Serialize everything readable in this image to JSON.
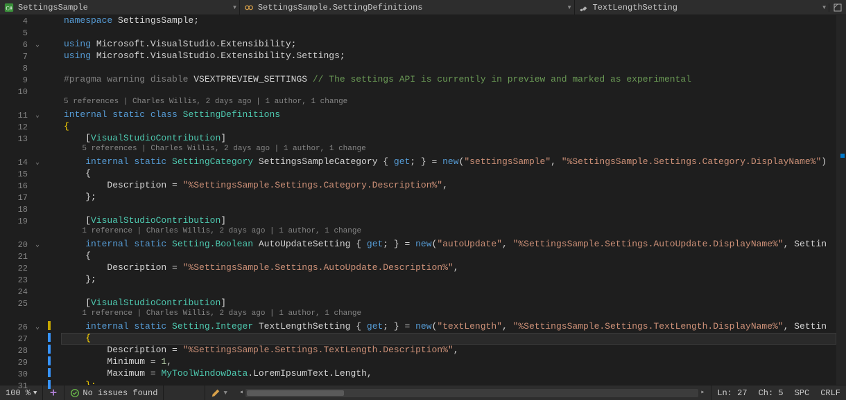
{
  "nav": {
    "file": "SettingsSample",
    "scope": "SettingsSample.SettingDefinitions",
    "member": "TextLengthSetting"
  },
  "lens": {
    "l1": "5 references | Charles Willis, 2 days ago | 1 author, 1 change",
    "l2": "5 references | Charles Willis, 2 days ago | 1 author, 1 change",
    "l3": "1 reference | Charles Willis, 2 days ago | 1 author, 1 change",
    "l4": "1 reference | Charles Willis, 2 days ago | 1 author, 1 change"
  },
  "ln": {
    "n4": "4",
    "n5": "5",
    "n6": "6",
    "n7": "7",
    "n8": "8",
    "n9": "9",
    "n10": "10",
    "n11": "11",
    "n12": "12",
    "n13": "13",
    "n14": "14",
    "n15": "15",
    "n16": "16",
    "n17": "17",
    "n18": "18",
    "n19": "19",
    "n20": "20",
    "n21": "21",
    "n22": "22",
    "n23": "23",
    "n24": "24",
    "n25": "25",
    "n26": "26",
    "n27": "27",
    "n28": "28",
    "n29": "29",
    "n30": "30",
    "n31": "31"
  },
  "code": {
    "l4_a": "namespace",
    "l4_b": " SettingsSample;",
    "l6_a": "using",
    "l6_b": " Microsoft.VisualStudio.Extensibility;",
    "l7_a": "using",
    "l7_b": " Microsoft.VisualStudio.Extensibility.Settings;",
    "l9_a": "#pragma warning disable",
    "l9_b": " VSEXTPREVIEW_SETTINGS ",
    "l9_c": "// The settings API is currently in preview and marked as experimental",
    "l11_a": "internal",
    "l11_b": " static",
    "l11_c": " class",
    "l11_d": " SettingDefinitions",
    "l12": "{",
    "l13_a": "    [",
    "l13_b": "VisualStudioContribution",
    "l13_c": "]",
    "l14_a": "    internal",
    "l14_b": " static",
    "l14_c": " SettingCategory",
    "l14_d": " SettingsSampleCategory { ",
    "l14_e": "get",
    "l14_f": "; } = ",
    "l14_g": "new",
    "l14_h": "(",
    "l14_i": "\"settingsSample\"",
    "l14_j": ", ",
    "l14_k": "\"%SettingsSample.Settings.Category.DisplayName%\"",
    "l14_l": ")",
    "l15": "    {",
    "l16_a": "        Description = ",
    "l16_b": "\"%SettingsSample.Settings.Category.Description%\"",
    "l16_c": ",",
    "l17": "    };",
    "l19_a": "    [",
    "l19_b": "VisualStudioContribution",
    "l19_c": "]",
    "l20_a": "    internal",
    "l20_b": " static",
    "l20_c": " Setting.Boolean",
    "l20_d": " AutoUpdateSetting { ",
    "l20_e": "get",
    "l20_f": "; } = ",
    "l20_g": "new",
    "l20_h": "(",
    "l20_i": "\"autoUpdate\"",
    "l20_j": ", ",
    "l20_k": "\"%SettingsSample.Settings.AutoUpdate.DisplayName%\"",
    "l20_l": ", Settin",
    "l21": "    {",
    "l22_a": "        Description = ",
    "l22_b": "\"%SettingsSample.Settings.AutoUpdate.Description%\"",
    "l22_c": ",",
    "l23": "    };",
    "l25_a": "    [",
    "l25_b": "VisualStudioContribution",
    "l25_c": "]",
    "l26_a": "    internal",
    "l26_b": " static",
    "l26_c": " Setting.Integer",
    "l26_d": " TextLengthSetting { ",
    "l26_e": "get",
    "l26_f": "; } = ",
    "l26_g": "new",
    "l26_h": "(",
    "l26_i": "\"textLength\"",
    "l26_j": ", ",
    "l26_k": "\"%SettingsSample.Settings.TextLength.DisplayName%\"",
    "l26_l": ", Settin",
    "l27": "    {",
    "l28_a": "        Description = ",
    "l28_b": "\"%SettingsSample.Settings.TextLength.Description%\"",
    "l28_c": ",",
    "l29_a": "        Minimum = ",
    "l29_b": "1",
    "l29_c": ",",
    "l30_a": "        Maximum = ",
    "l30_b": "MyToolWindowData",
    "l30_c": ".LoremIpsumText.Length,",
    "l31": "    };"
  },
  "status": {
    "zoom": "100 %",
    "issues": "No issues found",
    "lncol": "Ln: 27",
    "ch": "Ch: 5",
    "spc": "SPC",
    "crlf": "CRLF"
  }
}
